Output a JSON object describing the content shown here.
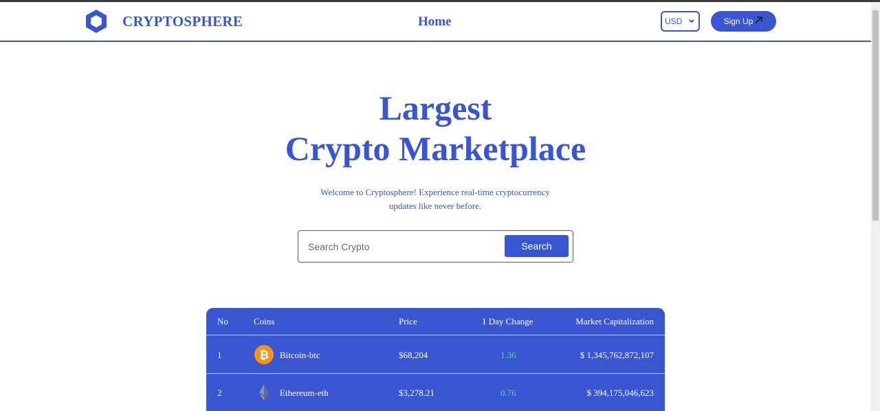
{
  "brand": {
    "name": "CRYPTOSPHERE",
    "logo_icon": "hexagon-logo-icon",
    "color": "#3a55d0"
  },
  "nav": {
    "home": "Home"
  },
  "currency": {
    "selected": "USD"
  },
  "signup": {
    "label": "Sign Up",
    "icon": "arrow-up-right-icon"
  },
  "hero": {
    "title_line1": "Largest",
    "title_line2": "Crypto Marketplace",
    "subtitle_line1": "Welcome to Cryptosphere! Experience real-time cryptocurrency",
    "subtitle_line2": "updates like never before."
  },
  "search": {
    "placeholder": "Search Crypto",
    "button": "Search"
  },
  "table": {
    "headers": {
      "no": "No",
      "coins": "Coins",
      "price": "Price",
      "change": "1 Day Change",
      "market_cap": "Market Capitalization"
    },
    "rows": [
      {
        "no": "1",
        "coin": "Bitcoin-btc",
        "icon": "bitcoin-icon",
        "price": "$68,204",
        "change": "1.36",
        "market_cap": "$ 1,345,762,872,107"
      },
      {
        "no": "2",
        "coin": "Ethereum-eth",
        "icon": "ethereum-icon",
        "price": "$3,278.21",
        "change": "0.76",
        "market_cap": "$ 394,175,046,623"
      }
    ],
    "positive_color": "#4ee28e"
  }
}
